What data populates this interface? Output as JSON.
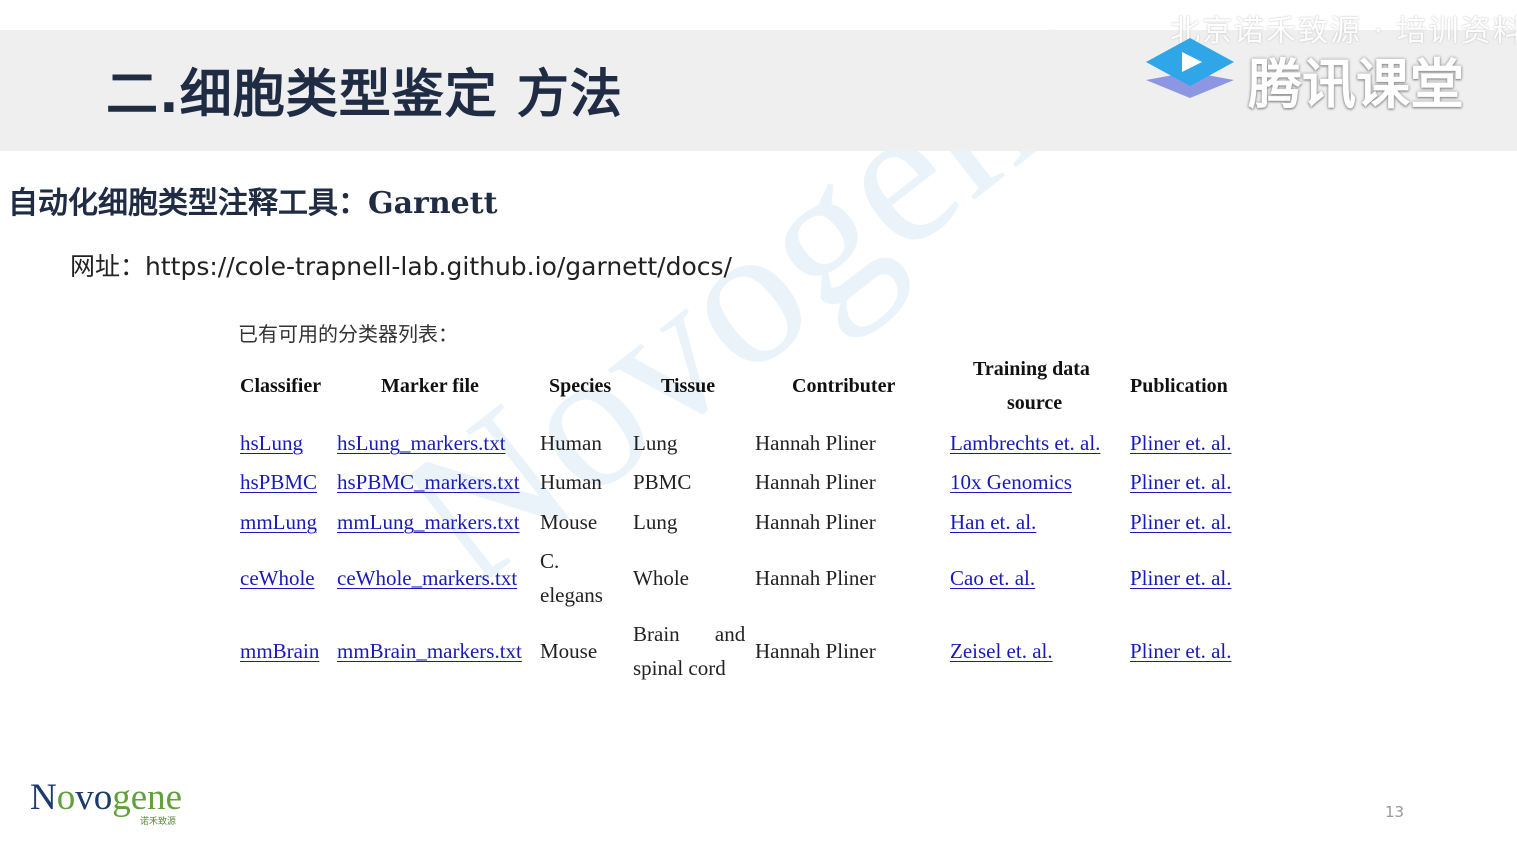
{
  "header": {
    "title": "二.细胞类型鉴定 方法",
    "watermark_top": "北京诺禾致源 · 培训资料",
    "platform": "腾讯课堂"
  },
  "subtitle": {
    "prefix": "自动化细胞类型注释工具：",
    "tool": "Garnett"
  },
  "url": {
    "label": "网址：",
    "value": "https://cole-trapnell-lab.github.io/garnett/docs/"
  },
  "table": {
    "caption": "已有可用的分类器列表：",
    "headers": {
      "classifier": "Classifier",
      "marker_file": "Marker file",
      "species": "Species",
      "tissue": "Tissue",
      "contributer": "Contributer",
      "training_line1": "Training data",
      "training_line2": "source",
      "publication": "Publication"
    },
    "rows": [
      {
        "classifier": "hsLung",
        "marker_file": "hsLung_markers.txt",
        "species": "Human",
        "tissue": "Lung",
        "contributer": "Hannah Pliner",
        "training": "Lambrechts et. al.",
        "publication": "Pliner et. al."
      },
      {
        "classifier": "hsPBMC",
        "marker_file": "hsPBMC_markers.txt",
        "species": "Human",
        "tissue": "PBMC",
        "contributer": "Hannah Pliner",
        "training": "10x Genomics",
        "publication": "Pliner et. al."
      },
      {
        "classifier": "mmLung",
        "marker_file": "mmLung_markers.txt",
        "species": "Mouse",
        "tissue": "Lung",
        "contributer": "Hannah Pliner",
        "training": "Han et. al.",
        "publication": "Pliner et. al."
      },
      {
        "classifier": "ceWhole",
        "marker_file": "ceWhole_markers.txt",
        "species_l1": "C.",
        "species_l2": "elegans",
        "tissue": "Whole",
        "contributer": "Hannah Pliner",
        "training": "Cao et. al.",
        "publication": "Pliner et. al."
      },
      {
        "classifier": "mmBrain",
        "marker_file": "mmBrain_markers.txt",
        "species": "Mouse",
        "tissue_l1": "Brain and",
        "tissue_l2": "spinal cord",
        "contributer": "Hannah Pliner",
        "training": "Zeisel et. al.",
        "publication": "Pliner et. al."
      }
    ]
  },
  "footer": {
    "logo_pre": "N",
    "logo_o": "o",
    "logo_mid": "vo",
    "logo_gene": "gene",
    "logo_sub": "诺禾致源",
    "page_number": "13"
  },
  "colors": {
    "title_text": "#1f2c44",
    "title_bar": "#efefef",
    "link": "#1a1ab8",
    "novogene_blue": "#1d3a6d",
    "novogene_green": "#5fa23b"
  }
}
